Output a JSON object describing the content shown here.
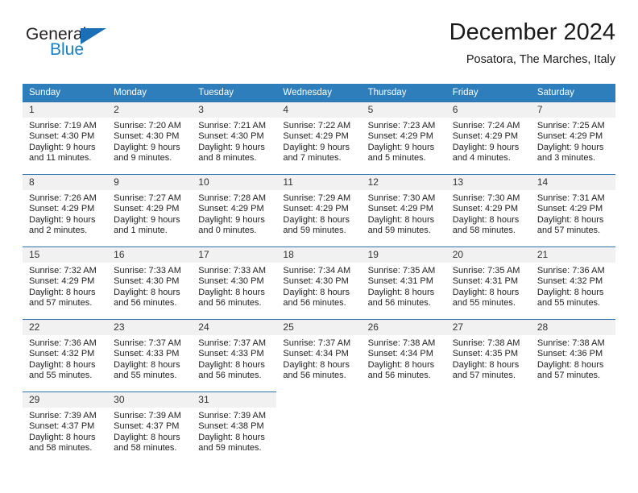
{
  "brand": {
    "name_part1": "General",
    "name_part2": "Blue",
    "triangle_color": "#1a6fb5",
    "blue_color": "#1a7fc1"
  },
  "header": {
    "title": "December 2024",
    "subtitle": "Posatora, The Marches, Italy"
  },
  "theme": {
    "header_row_bg": "#2e7ebb",
    "day_band_bg": "#f1f1f1",
    "day_top_border": "#2e6fae"
  },
  "weekdays": [
    "Sunday",
    "Monday",
    "Tuesday",
    "Wednesday",
    "Thursday",
    "Friday",
    "Saturday"
  ],
  "weeks": [
    [
      {
        "day": "1",
        "sunrise": "Sunrise: 7:19 AM",
        "sunset": "Sunset: 4:30 PM",
        "daylight_line1": "Daylight: 9 hours",
        "daylight_line2": "and 11 minutes."
      },
      {
        "day": "2",
        "sunrise": "Sunrise: 7:20 AM",
        "sunset": "Sunset: 4:30 PM",
        "daylight_line1": "Daylight: 9 hours",
        "daylight_line2": "and 9 minutes."
      },
      {
        "day": "3",
        "sunrise": "Sunrise: 7:21 AM",
        "sunset": "Sunset: 4:30 PM",
        "daylight_line1": "Daylight: 9 hours",
        "daylight_line2": "and 8 minutes."
      },
      {
        "day": "4",
        "sunrise": "Sunrise: 7:22 AM",
        "sunset": "Sunset: 4:29 PM",
        "daylight_line1": "Daylight: 9 hours",
        "daylight_line2": "and 7 minutes."
      },
      {
        "day": "5",
        "sunrise": "Sunrise: 7:23 AM",
        "sunset": "Sunset: 4:29 PM",
        "daylight_line1": "Daylight: 9 hours",
        "daylight_line2": "and 5 minutes."
      },
      {
        "day": "6",
        "sunrise": "Sunrise: 7:24 AM",
        "sunset": "Sunset: 4:29 PM",
        "daylight_line1": "Daylight: 9 hours",
        "daylight_line2": "and 4 minutes."
      },
      {
        "day": "7",
        "sunrise": "Sunrise: 7:25 AM",
        "sunset": "Sunset: 4:29 PM",
        "daylight_line1": "Daylight: 9 hours",
        "daylight_line2": "and 3 minutes."
      }
    ],
    [
      {
        "day": "8",
        "sunrise": "Sunrise: 7:26 AM",
        "sunset": "Sunset: 4:29 PM",
        "daylight_line1": "Daylight: 9 hours",
        "daylight_line2": "and 2 minutes."
      },
      {
        "day": "9",
        "sunrise": "Sunrise: 7:27 AM",
        "sunset": "Sunset: 4:29 PM",
        "daylight_line1": "Daylight: 9 hours",
        "daylight_line2": "and 1 minute."
      },
      {
        "day": "10",
        "sunrise": "Sunrise: 7:28 AM",
        "sunset": "Sunset: 4:29 PM",
        "daylight_line1": "Daylight: 9 hours",
        "daylight_line2": "and 0 minutes."
      },
      {
        "day": "11",
        "sunrise": "Sunrise: 7:29 AM",
        "sunset": "Sunset: 4:29 PM",
        "daylight_line1": "Daylight: 8 hours",
        "daylight_line2": "and 59 minutes."
      },
      {
        "day": "12",
        "sunrise": "Sunrise: 7:30 AM",
        "sunset": "Sunset: 4:29 PM",
        "daylight_line1": "Daylight: 8 hours",
        "daylight_line2": "and 59 minutes."
      },
      {
        "day": "13",
        "sunrise": "Sunrise: 7:30 AM",
        "sunset": "Sunset: 4:29 PM",
        "daylight_line1": "Daylight: 8 hours",
        "daylight_line2": "and 58 minutes."
      },
      {
        "day": "14",
        "sunrise": "Sunrise: 7:31 AM",
        "sunset": "Sunset: 4:29 PM",
        "daylight_line1": "Daylight: 8 hours",
        "daylight_line2": "and 57 minutes."
      }
    ],
    [
      {
        "day": "15",
        "sunrise": "Sunrise: 7:32 AM",
        "sunset": "Sunset: 4:29 PM",
        "daylight_line1": "Daylight: 8 hours",
        "daylight_line2": "and 57 minutes."
      },
      {
        "day": "16",
        "sunrise": "Sunrise: 7:33 AM",
        "sunset": "Sunset: 4:30 PM",
        "daylight_line1": "Daylight: 8 hours",
        "daylight_line2": "and 56 minutes."
      },
      {
        "day": "17",
        "sunrise": "Sunrise: 7:33 AM",
        "sunset": "Sunset: 4:30 PM",
        "daylight_line1": "Daylight: 8 hours",
        "daylight_line2": "and 56 minutes."
      },
      {
        "day": "18",
        "sunrise": "Sunrise: 7:34 AM",
        "sunset": "Sunset: 4:30 PM",
        "daylight_line1": "Daylight: 8 hours",
        "daylight_line2": "and 56 minutes."
      },
      {
        "day": "19",
        "sunrise": "Sunrise: 7:35 AM",
        "sunset": "Sunset: 4:31 PM",
        "daylight_line1": "Daylight: 8 hours",
        "daylight_line2": "and 56 minutes."
      },
      {
        "day": "20",
        "sunrise": "Sunrise: 7:35 AM",
        "sunset": "Sunset: 4:31 PM",
        "daylight_line1": "Daylight: 8 hours",
        "daylight_line2": "and 55 minutes."
      },
      {
        "day": "21",
        "sunrise": "Sunrise: 7:36 AM",
        "sunset": "Sunset: 4:32 PM",
        "daylight_line1": "Daylight: 8 hours",
        "daylight_line2": "and 55 minutes."
      }
    ],
    [
      {
        "day": "22",
        "sunrise": "Sunrise: 7:36 AM",
        "sunset": "Sunset: 4:32 PM",
        "daylight_line1": "Daylight: 8 hours",
        "daylight_line2": "and 55 minutes."
      },
      {
        "day": "23",
        "sunrise": "Sunrise: 7:37 AM",
        "sunset": "Sunset: 4:33 PM",
        "daylight_line1": "Daylight: 8 hours",
        "daylight_line2": "and 55 minutes."
      },
      {
        "day": "24",
        "sunrise": "Sunrise: 7:37 AM",
        "sunset": "Sunset: 4:33 PM",
        "daylight_line1": "Daylight: 8 hours",
        "daylight_line2": "and 56 minutes."
      },
      {
        "day": "25",
        "sunrise": "Sunrise: 7:37 AM",
        "sunset": "Sunset: 4:34 PM",
        "daylight_line1": "Daylight: 8 hours",
        "daylight_line2": "and 56 minutes."
      },
      {
        "day": "26",
        "sunrise": "Sunrise: 7:38 AM",
        "sunset": "Sunset: 4:34 PM",
        "daylight_line1": "Daylight: 8 hours",
        "daylight_line2": "and 56 minutes."
      },
      {
        "day": "27",
        "sunrise": "Sunrise: 7:38 AM",
        "sunset": "Sunset: 4:35 PM",
        "daylight_line1": "Daylight: 8 hours",
        "daylight_line2": "and 57 minutes."
      },
      {
        "day": "28",
        "sunrise": "Sunrise: 7:38 AM",
        "sunset": "Sunset: 4:36 PM",
        "daylight_line1": "Daylight: 8 hours",
        "daylight_line2": "and 57 minutes."
      }
    ],
    [
      {
        "day": "29",
        "sunrise": "Sunrise: 7:39 AM",
        "sunset": "Sunset: 4:37 PM",
        "daylight_line1": "Daylight: 8 hours",
        "daylight_line2": "and 58 minutes."
      },
      {
        "day": "30",
        "sunrise": "Sunrise: 7:39 AM",
        "sunset": "Sunset: 4:37 PM",
        "daylight_line1": "Daylight: 8 hours",
        "daylight_line2": "and 58 minutes."
      },
      {
        "day": "31",
        "sunrise": "Sunrise: 7:39 AM",
        "sunset": "Sunset: 4:38 PM",
        "daylight_line1": "Daylight: 8 hours",
        "daylight_line2": "and 59 minutes."
      },
      null,
      null,
      null,
      null
    ]
  ]
}
